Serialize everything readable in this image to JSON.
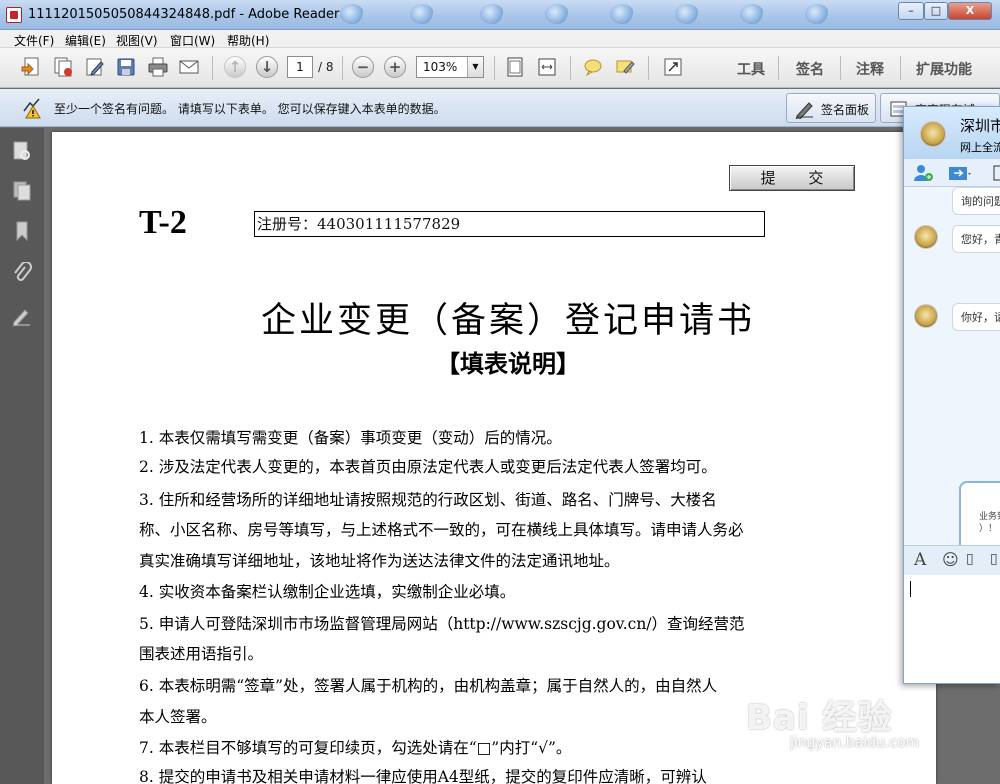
{
  "window": {
    "title": "1111201505050844324848.pdf - Adobe Reader",
    "controls": {
      "minimize": "–",
      "maximize": "□",
      "close": "X"
    }
  },
  "menu": [
    "文件(F)",
    "编辑(E)",
    "视图(V)",
    "窗口(W)",
    "帮助(H)"
  ],
  "toolbar": {
    "page_current": "1",
    "page_total": "/ 8",
    "zoom": "103%",
    "right_tools": [
      "工具",
      "签名",
      "注释",
      "扩展功能"
    ]
  },
  "message_bar": {
    "text": "至少一个签名有问题。  请填写以下表单。  您可以保存键入本表单的数据。",
    "signature_panel_label": "签名面板",
    "highlight_fields_label": "高亮现有域"
  },
  "document": {
    "submit_label": "提 交",
    "form_code": "T-2",
    "registration_label": "注册号：440301111577829",
    "title": "企业变更（备案）登记申请书",
    "subtitle": "【填表说明】",
    "instructions": [
      "1.  本表仅需填写需变更（备案）事项变更（变动）后的情况。",
      "2.  涉及法定代表人变更的，本表首页由原法定代表人或变更后法定代表人签署均可。",
      "3.  住所和经营场所的详细地址请按照规范的行政区划、街道、路名、门牌号、大楼名",
      "称、小区名称、房号等填写，与上述格式不一致的，可在横线上具体填写。请申请人务必",
      "真实准确填写详细地址，该地址将作为送达法律文件的法定通讯地址。",
      "4.  实收资本备案栏认缴制企业选填，实缴制企业必填。",
      "5.  申请人可登陆深圳市市场监督管理局网站（http://www.szscjg.gov.cn/）查询经营范",
      "围表述用语指引。",
      "6.  本表标明需“签章”处，签署人属于机构的，由机构盖章；属于自然人的，由自然人",
      "本人签署。",
      "7.  本表栏目不够填写的可复印续页，勾选处请在“□”内打“√”。",
      "8.  提交的申请书及相关申请材料一律应使用A4型纸，提交的复印件应清晰，可辨认"
    ]
  },
  "chat": {
    "name": "深圳市",
    "subtitle": "网上全流",
    "messages": [
      "询的问题",
      "您好，青",
      "你好，请"
    ],
    "card_text": [
      "业务到",
      "）！"
    ]
  },
  "watermark": {
    "main": "Bai 经验",
    "sub": "jingyan.baidu.com"
  }
}
